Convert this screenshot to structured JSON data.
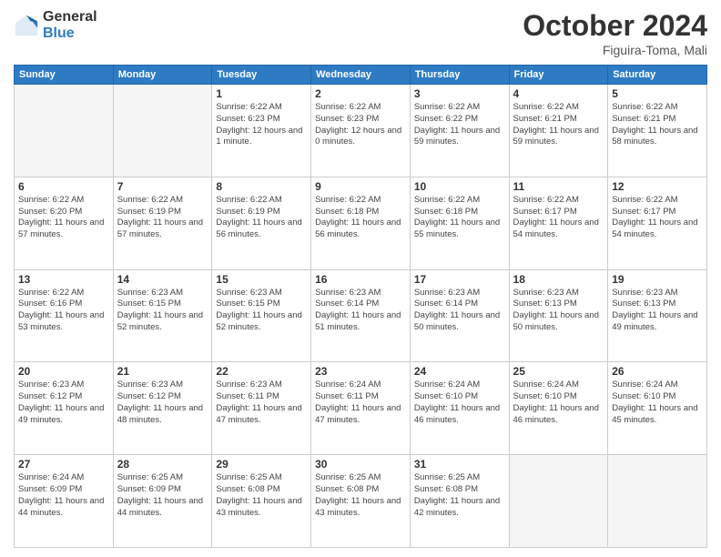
{
  "header": {
    "logo_general": "General",
    "logo_blue": "Blue",
    "month_title": "October 2024",
    "location": "Figuira-Toma, Mali"
  },
  "weekdays": [
    "Sunday",
    "Monday",
    "Tuesday",
    "Wednesday",
    "Thursday",
    "Friday",
    "Saturday"
  ],
  "weeks": [
    [
      {
        "day": "",
        "empty": true
      },
      {
        "day": "",
        "empty": true
      },
      {
        "day": "1",
        "sunrise": "6:22 AM",
        "sunset": "6:23 PM",
        "daylight": "12 hours and 1 minute."
      },
      {
        "day": "2",
        "sunrise": "6:22 AM",
        "sunset": "6:23 PM",
        "daylight": "12 hours and 0 minutes."
      },
      {
        "day": "3",
        "sunrise": "6:22 AM",
        "sunset": "6:22 PM",
        "daylight": "11 hours and 59 minutes."
      },
      {
        "day": "4",
        "sunrise": "6:22 AM",
        "sunset": "6:21 PM",
        "daylight": "11 hours and 59 minutes."
      },
      {
        "day": "5",
        "sunrise": "6:22 AM",
        "sunset": "6:21 PM",
        "daylight": "11 hours and 58 minutes."
      }
    ],
    [
      {
        "day": "6",
        "sunrise": "6:22 AM",
        "sunset": "6:20 PM",
        "daylight": "11 hours and 57 minutes."
      },
      {
        "day": "7",
        "sunrise": "6:22 AM",
        "sunset": "6:19 PM",
        "daylight": "11 hours and 57 minutes."
      },
      {
        "day": "8",
        "sunrise": "6:22 AM",
        "sunset": "6:19 PM",
        "daylight": "11 hours and 56 minutes."
      },
      {
        "day": "9",
        "sunrise": "6:22 AM",
        "sunset": "6:18 PM",
        "daylight": "11 hours and 56 minutes."
      },
      {
        "day": "10",
        "sunrise": "6:22 AM",
        "sunset": "6:18 PM",
        "daylight": "11 hours and 55 minutes."
      },
      {
        "day": "11",
        "sunrise": "6:22 AM",
        "sunset": "6:17 PM",
        "daylight": "11 hours and 54 minutes."
      },
      {
        "day": "12",
        "sunrise": "6:22 AM",
        "sunset": "6:17 PM",
        "daylight": "11 hours and 54 minutes."
      }
    ],
    [
      {
        "day": "13",
        "sunrise": "6:22 AM",
        "sunset": "6:16 PM",
        "daylight": "11 hours and 53 minutes."
      },
      {
        "day": "14",
        "sunrise": "6:23 AM",
        "sunset": "6:15 PM",
        "daylight": "11 hours and 52 minutes."
      },
      {
        "day": "15",
        "sunrise": "6:23 AM",
        "sunset": "6:15 PM",
        "daylight": "11 hours and 52 minutes."
      },
      {
        "day": "16",
        "sunrise": "6:23 AM",
        "sunset": "6:14 PM",
        "daylight": "11 hours and 51 minutes."
      },
      {
        "day": "17",
        "sunrise": "6:23 AM",
        "sunset": "6:14 PM",
        "daylight": "11 hours and 50 minutes."
      },
      {
        "day": "18",
        "sunrise": "6:23 AM",
        "sunset": "6:13 PM",
        "daylight": "11 hours and 50 minutes."
      },
      {
        "day": "19",
        "sunrise": "6:23 AM",
        "sunset": "6:13 PM",
        "daylight": "11 hours and 49 minutes."
      }
    ],
    [
      {
        "day": "20",
        "sunrise": "6:23 AM",
        "sunset": "6:12 PM",
        "daylight": "11 hours and 49 minutes."
      },
      {
        "day": "21",
        "sunrise": "6:23 AM",
        "sunset": "6:12 PM",
        "daylight": "11 hours and 48 minutes."
      },
      {
        "day": "22",
        "sunrise": "6:23 AM",
        "sunset": "6:11 PM",
        "daylight": "11 hours and 47 minutes."
      },
      {
        "day": "23",
        "sunrise": "6:24 AM",
        "sunset": "6:11 PM",
        "daylight": "11 hours and 47 minutes."
      },
      {
        "day": "24",
        "sunrise": "6:24 AM",
        "sunset": "6:10 PM",
        "daylight": "11 hours and 46 minutes."
      },
      {
        "day": "25",
        "sunrise": "6:24 AM",
        "sunset": "6:10 PM",
        "daylight": "11 hours and 46 minutes."
      },
      {
        "day": "26",
        "sunrise": "6:24 AM",
        "sunset": "6:10 PM",
        "daylight": "11 hours and 45 minutes."
      }
    ],
    [
      {
        "day": "27",
        "sunrise": "6:24 AM",
        "sunset": "6:09 PM",
        "daylight": "11 hours and 44 minutes."
      },
      {
        "day": "28",
        "sunrise": "6:25 AM",
        "sunset": "6:09 PM",
        "daylight": "11 hours and 44 minutes."
      },
      {
        "day": "29",
        "sunrise": "6:25 AM",
        "sunset": "6:08 PM",
        "daylight": "11 hours and 43 minutes."
      },
      {
        "day": "30",
        "sunrise": "6:25 AM",
        "sunset": "6:08 PM",
        "daylight": "11 hours and 43 minutes."
      },
      {
        "day": "31",
        "sunrise": "6:25 AM",
        "sunset": "6:08 PM",
        "daylight": "11 hours and 42 minutes."
      },
      {
        "day": "",
        "empty": true
      },
      {
        "day": "",
        "empty": true
      }
    ]
  ]
}
